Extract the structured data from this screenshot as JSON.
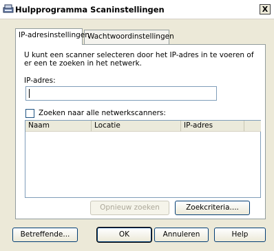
{
  "window": {
    "title": "Hulpprogramma Scaninstellingen",
    "close_label": "X"
  },
  "tabs": [
    {
      "label": "IP-adresinstellingen",
      "active": true
    },
    {
      "label": "Wachtwoordinstellingen",
      "active": false
    }
  ],
  "ip_tab": {
    "description": "U kunt een scanner selecteren door het IP-adres in te voeren of er een te zoeken in het netwerk.",
    "ip_label": "IP-adres:",
    "ip_value": "",
    "search_all_label": "Zoeken naar alle netwerkscanners:",
    "search_all_checked": false,
    "list_columns": [
      "Naam",
      "Locatie",
      "IP-adres",
      ""
    ],
    "list_rows": [],
    "search_again_label": "Opnieuw zoeken",
    "search_criteria_label": "Zoekcriteria...."
  },
  "footer": {
    "about_label": "Betreffende...",
    "ok_label": "OK",
    "cancel_label": "Annuleren",
    "help_label": "Help"
  }
}
